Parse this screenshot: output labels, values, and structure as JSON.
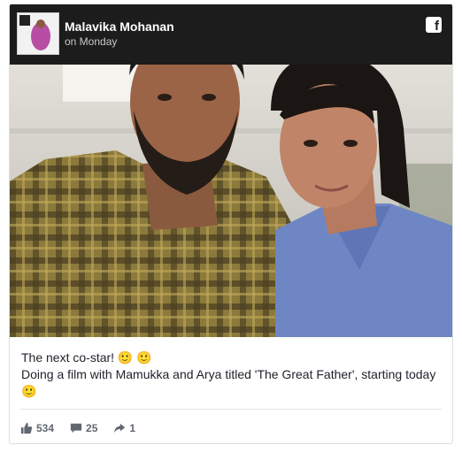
{
  "post": {
    "author": "Malavika Mohanan",
    "time": "on Monday",
    "caption_line1": "The next co-star! 🙂 🙂",
    "caption_line2": "Doing a film with Mamukka and Arya titled 'The Great Father', starting today 🙂",
    "icons": [
      "facebook-icon",
      "like-icon",
      "comment-icon",
      "share-icon"
    ]
  },
  "stats": {
    "likes": "534",
    "comments": "25",
    "shares": "1"
  },
  "colors": {
    "header_bg": "#1c1c1c",
    "text": "#1d2129",
    "meta": "#616770"
  }
}
